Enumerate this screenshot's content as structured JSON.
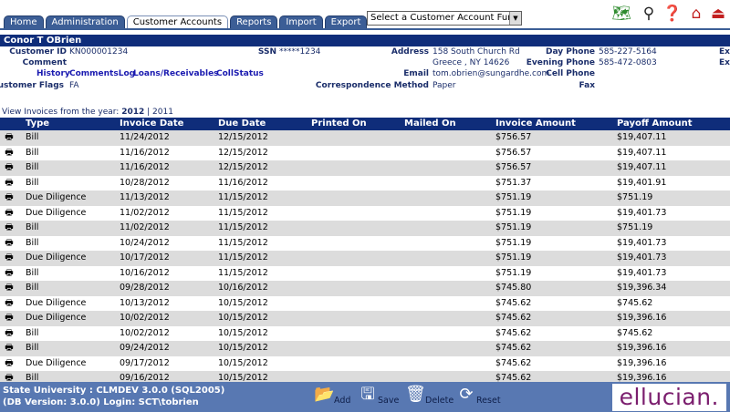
{
  "tabs": [
    {
      "label": "Home"
    },
    {
      "label": "Administration"
    },
    {
      "label": "Customer Accounts"
    },
    {
      "label": "Reports"
    },
    {
      "label": "Import"
    },
    {
      "label": "Export"
    }
  ],
  "function_select": {
    "value": "Select a Customer Account Function"
  },
  "customer": {
    "name": "Conor T OBrien",
    "labels": {
      "customer_id": "Customer ID",
      "comment": "Comment",
      "ssn": "SSN",
      "address": "Address",
      "email": "Email",
      "correspondence": "Correspondence Method",
      "day_phone": "Day Phone",
      "evening_phone": "Evening Phone",
      "cell_phone": "Cell Phone",
      "fax": "Fax",
      "flags": "Customer Flags",
      "ex1": "Ex",
      "ex2": "Ex"
    },
    "customer_id": "KN000001234",
    "ssn": "*****1234",
    "address_line1": "158 South Church Rd",
    "address_line2": "Greece , NY 14626",
    "email": "tom.obrien@sungardhe.com",
    "correspondence": "Paper",
    "day_phone": "585-227-5164",
    "evening_phone": "585-472-0803",
    "flags": "FA",
    "links": {
      "history": "History",
      "comments_log": "CommentsLog",
      "loans": "Loans/Receivables",
      "coll_status": "CollStatus"
    }
  },
  "year_filter": {
    "prefix": "View Invoices from the year: ",
    "current": "2012",
    "sep": " | ",
    "other": "2011"
  },
  "table": {
    "headers": {
      "type": "Type",
      "invoice_date": "Invoice Date",
      "due_date": "Due Date",
      "printed_on": "Printed On",
      "mailed_on": "Mailed On",
      "invoice_amount": "Invoice Amount",
      "payoff_amount": "Payoff Amount"
    },
    "rows": [
      {
        "type": "Bill",
        "invoice_date": "11/24/2012",
        "due_date": "12/15/2012",
        "invoice_amount": "$756.57",
        "payoff_amount": "$19,407.11"
      },
      {
        "type": "Bill",
        "invoice_date": "11/16/2012",
        "due_date": "12/15/2012",
        "invoice_amount": "$756.57",
        "payoff_amount": "$19,407.11"
      },
      {
        "type": "Bill",
        "invoice_date": "11/16/2012",
        "due_date": "12/15/2012",
        "invoice_amount": "$756.57",
        "payoff_amount": "$19,407.11"
      },
      {
        "type": "Bill",
        "invoice_date": "10/28/2012",
        "due_date": "11/16/2012",
        "invoice_amount": "$751.37",
        "payoff_amount": "$19,401.91"
      },
      {
        "type": "Due Diligence",
        "invoice_date": "11/13/2012",
        "due_date": "11/15/2012",
        "invoice_amount": "$751.19",
        "payoff_amount": "$751.19"
      },
      {
        "type": "Due Diligence",
        "invoice_date": "11/02/2012",
        "due_date": "11/15/2012",
        "invoice_amount": "$751.19",
        "payoff_amount": "$19,401.73"
      },
      {
        "type": "Bill",
        "invoice_date": "11/02/2012",
        "due_date": "11/15/2012",
        "invoice_amount": "$751.19",
        "payoff_amount": "$751.19"
      },
      {
        "type": "Bill",
        "invoice_date": "10/24/2012",
        "due_date": "11/15/2012",
        "invoice_amount": "$751.19",
        "payoff_amount": "$19,401.73"
      },
      {
        "type": "Due Diligence",
        "invoice_date": "10/17/2012",
        "due_date": "11/15/2012",
        "invoice_amount": "$751.19",
        "payoff_amount": "$19,401.73"
      },
      {
        "type": "Bill",
        "invoice_date": "10/16/2012",
        "due_date": "11/15/2012",
        "invoice_amount": "$751.19",
        "payoff_amount": "$19,401.73"
      },
      {
        "type": "Bill",
        "invoice_date": "09/28/2012",
        "due_date": "10/16/2012",
        "invoice_amount": "$745.80",
        "payoff_amount": "$19,396.34"
      },
      {
        "type": "Due Diligence",
        "invoice_date": "10/13/2012",
        "due_date": "10/15/2012",
        "invoice_amount": "$745.62",
        "payoff_amount": "$745.62"
      },
      {
        "type": "Due Diligence",
        "invoice_date": "10/02/2012",
        "due_date": "10/15/2012",
        "invoice_amount": "$745.62",
        "payoff_amount": "$19,396.16"
      },
      {
        "type": "Bill",
        "invoice_date": "10/02/2012",
        "due_date": "10/15/2012",
        "invoice_amount": "$745.62",
        "payoff_amount": "$745.62"
      },
      {
        "type": "Bill",
        "invoice_date": "09/24/2012",
        "due_date": "10/15/2012",
        "invoice_amount": "$745.62",
        "payoff_amount": "$19,396.16"
      },
      {
        "type": "Due Diligence",
        "invoice_date": "09/17/2012",
        "due_date": "10/15/2012",
        "invoice_amount": "$745.62",
        "payoff_amount": "$19,396.16"
      },
      {
        "type": "Bill",
        "invoice_date": "09/16/2012",
        "due_date": "10/15/2012",
        "invoice_amount": "$745.62",
        "payoff_amount": "$19,396.16"
      }
    ]
  },
  "footer": {
    "line1": "State University : CLMDEV 3.0.0 (SQL2005)",
    "line2": "(DB Version: 3.0.0) Login: SCT\\tobrien",
    "buttons": {
      "add": "Add",
      "save": "Save",
      "delete": "Delete",
      "reset": "Reset"
    },
    "logo": "ellucian."
  },
  "icons": {
    "toolbar": [
      "map-icon",
      "binoculars-icon",
      "help-document-icon",
      "home-icon",
      "exit-icon"
    ],
    "row": "printer-icon",
    "footer": [
      "add-folder-icon",
      "save-icon",
      "delete-trash-icon",
      "reset-icon"
    ]
  },
  "colors": {
    "header_band": "#0f2d7a",
    "footer": "#5878b2",
    "row_alt": "#dcdcdc",
    "logo": "#7b1e6e"
  }
}
